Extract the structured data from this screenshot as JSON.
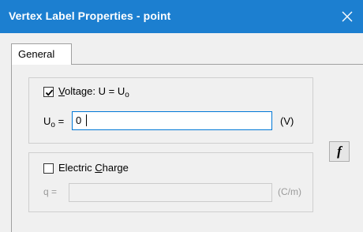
{
  "window": {
    "title": "Vertex Label Properties - point",
    "close_glyph": "✕"
  },
  "tabs": [
    {
      "label": "General",
      "selected": true
    }
  ],
  "voltage": {
    "checked": true,
    "label_prefix": "",
    "label_mnemonic": "V",
    "label_rest": "oltage: U = U",
    "label_sub": "o",
    "field_label": "U",
    "field_label_sub": "o",
    "field_label_eq": " =",
    "value": "0",
    "unit": "(V)"
  },
  "charge": {
    "checked": false,
    "label_prefix": "Electric ",
    "label_mnemonic": "C",
    "label_rest": "harge",
    "field_label": "q =",
    "value": "",
    "unit": "(C/m)"
  },
  "function_button": {
    "label": "f",
    "icon": "function-icon"
  },
  "colors": {
    "titlebar": "#1c7fd0",
    "focus_border": "#0078d7"
  }
}
